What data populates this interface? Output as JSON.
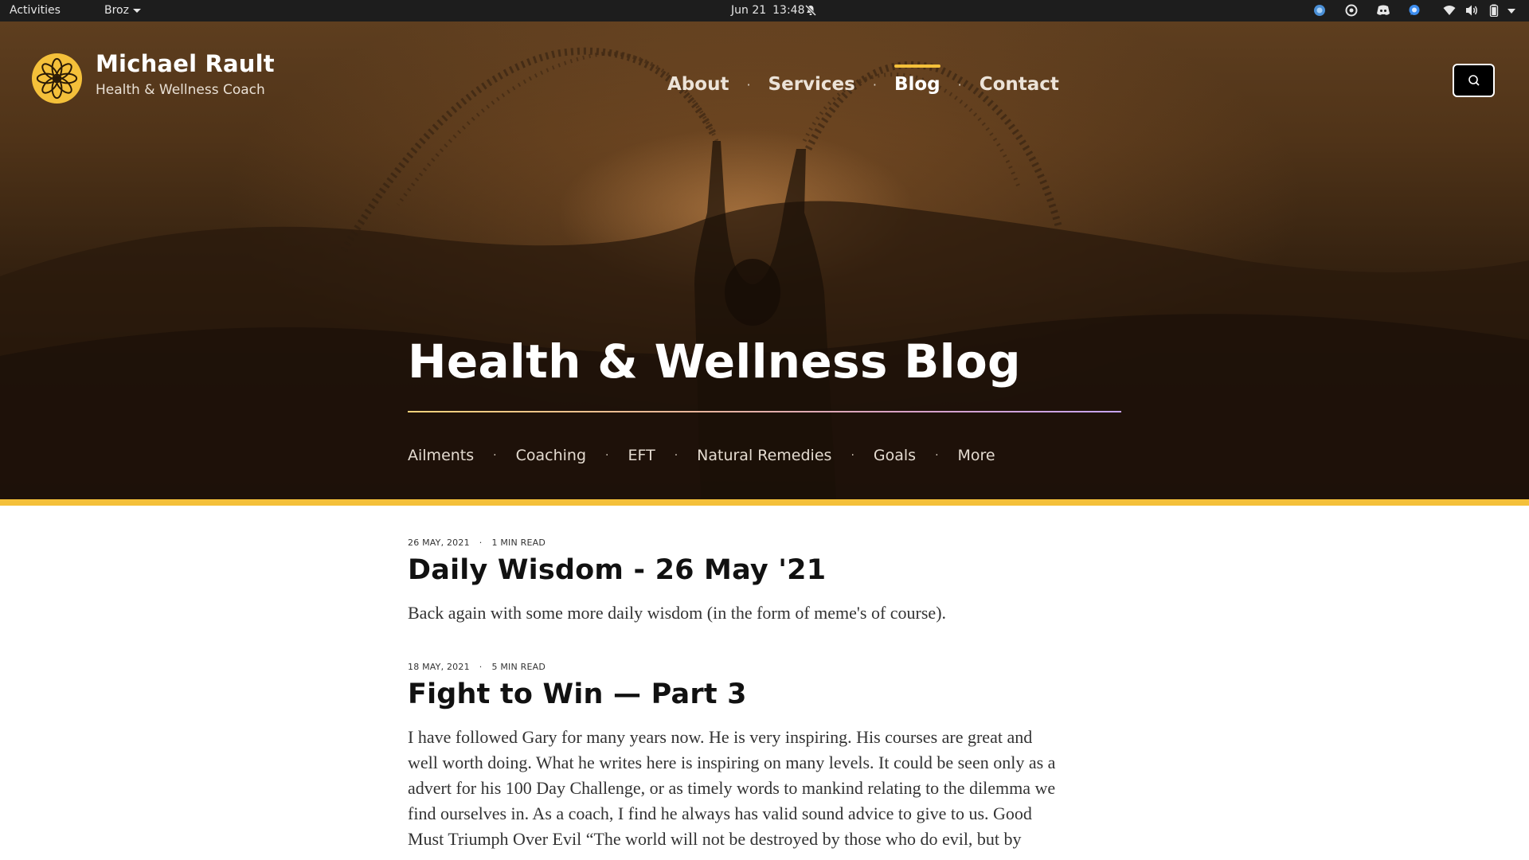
{
  "system_bar": {
    "activities": "Activities",
    "app_name": "Broz",
    "date": "Jun 21",
    "time": "13:48"
  },
  "site": {
    "name": "Michael Rault",
    "tagline": "Health & Wellness Coach",
    "accent_color": "#f4c03a"
  },
  "main_nav": {
    "items": [
      {
        "label": "About",
        "active": false
      },
      {
        "label": "Services",
        "active": false
      },
      {
        "label": "Blog",
        "active": true
      },
      {
        "label": "Contact",
        "active": false
      }
    ],
    "separator": "·"
  },
  "hero": {
    "title": "Health & Wellness Blog"
  },
  "category_nav": {
    "items": [
      {
        "label": "Ailments"
      },
      {
        "label": "Coaching"
      },
      {
        "label": "EFT"
      },
      {
        "label": "Natural Remedies"
      },
      {
        "label": "Goals"
      },
      {
        "label": "More"
      }
    ],
    "separator": "·"
  },
  "posts": [
    {
      "date": "26 MAY, 2021",
      "read_time": "1 MIN READ",
      "title": "Daily Wisdom - 26 May '21",
      "excerpt": "Back again with some more daily wisdom (in the form of meme's of course)."
    },
    {
      "date": "18 MAY, 2021",
      "read_time": "5 MIN READ",
      "title": "Fight to Win — Part 3",
      "excerpt_lines": [
        "I have followed Gary for many years now. He is very inspiring. His courses are great and",
        "well worth doing. What he writes here is inspiring on many levels. It could be seen only as a",
        "advert for his 100 Day Challenge, or as timely words to mankind relating to the dilemma we",
        "find ourselves in. As a coach, I find he always has valid sound advice to give to us. Good",
        "Must Triumph Over Evil “The world will not be destroyed by those who do evil, but by"
      ]
    }
  ],
  "icons": {
    "search": "search-icon",
    "logo": "flower-logo-icon",
    "bell": "bell-muted-icon",
    "tray": [
      "browser-tray-icon",
      "circle-tray-icon",
      "discord-tray-icon",
      "chat-tray-icon",
      "wifi-icon",
      "volume-icon",
      "battery-icon",
      "system-menu-caret-icon"
    ]
  }
}
